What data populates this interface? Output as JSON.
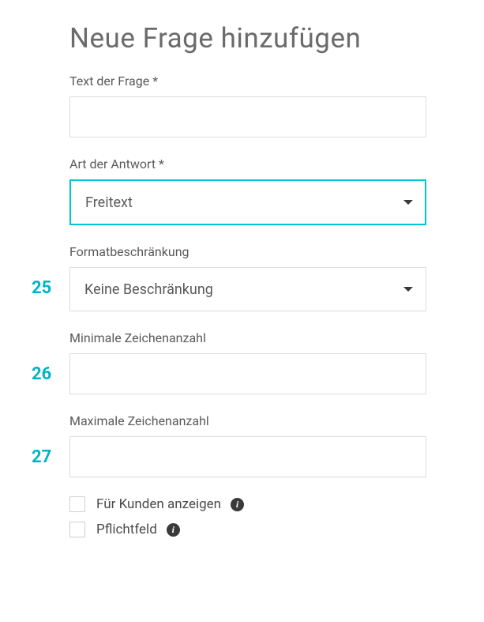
{
  "page_title": "Neue Frage hinzufügen",
  "fields": {
    "question_text": {
      "label": "Text der Frage *",
      "value": ""
    },
    "answer_type": {
      "label": "Art der Antwort *",
      "value": "Freitext"
    },
    "format_restriction": {
      "label": "Formatbeschränkung",
      "value": "Keine Beschränkung",
      "annotation": "25"
    },
    "min_chars": {
      "label": "Minimale Zeichenanzahl",
      "value": "",
      "annotation": "26"
    },
    "max_chars": {
      "label": "Maximale Zeichenanzahl",
      "value": "",
      "annotation": "27"
    }
  },
  "checkboxes": {
    "show_customers": {
      "label": "Für Kunden anzeigen"
    },
    "required_field": {
      "label": "Pflichtfeld"
    }
  }
}
